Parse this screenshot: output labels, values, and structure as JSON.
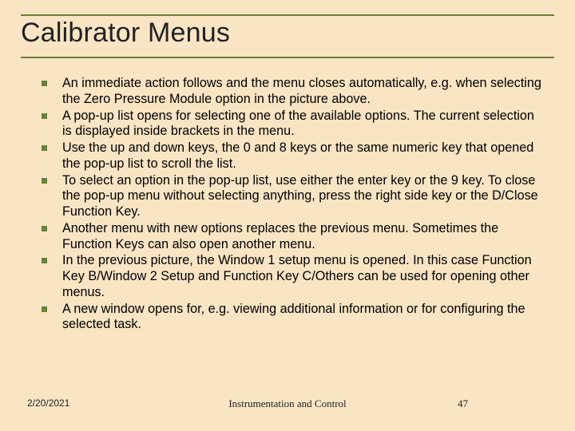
{
  "title": "Calibrator Menus",
  "bullets": [
    "An immediate action follows and the menu closes automatically, e.g. when selecting the Zero Pressure Module option in the picture above.",
    "A pop-up list opens for selecting one of the available options. The current selection is displayed inside brackets in the menu.",
    "Use the up and down keys, the 0 and 8 keys or the same numeric key that opened the pop-up list to scroll the list.",
    "To select an option in the pop-up list, use either the enter key or the 9 key. To close the pop-up menu without selecting anything, press the right side key or the D/Close Function Key.",
    "Another menu with new options replaces the previous menu. Sometimes the Function Keys can also open another menu.",
    "In the previous picture, the Window 1 setup menu is opened. In this case Function Key B/Window 2 Setup and Function Key  C/Others can be used for opening other menus.",
    "A new window opens for, e.g. viewing additional information or for configuring the selected task."
  ],
  "footer": {
    "date": "2/20/2021",
    "center": "Instrumentation and Control",
    "page": "47"
  }
}
